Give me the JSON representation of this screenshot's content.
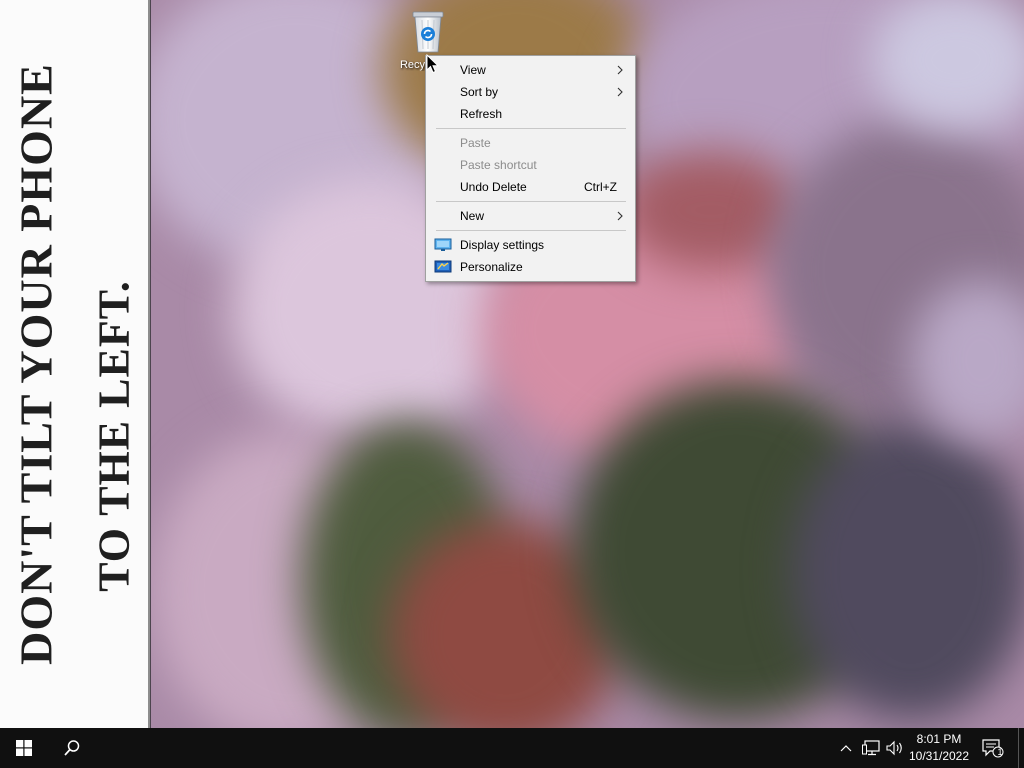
{
  "wallpaper": {
    "line1": "DON'T TILT YOUR PHONE",
    "line2": "TO THE LEFT."
  },
  "desktop": {
    "icons": [
      {
        "label": "Recycle Bin",
        "icon": "recycle-bin-icon"
      }
    ]
  },
  "context_menu": {
    "view": {
      "label": "View",
      "has_submenu": true
    },
    "sort_by": {
      "label": "Sort by",
      "has_submenu": true
    },
    "refresh": {
      "label": "Refresh"
    },
    "paste": {
      "label": "Paste",
      "disabled": true
    },
    "paste_shortcut": {
      "label": "Paste shortcut",
      "disabled": true
    },
    "undo_delete": {
      "label": "Undo Delete",
      "shortcut": "Ctrl+Z"
    },
    "new": {
      "label": "New",
      "has_submenu": true
    },
    "display_settings": {
      "label": "Display settings",
      "icon": "display-icon"
    },
    "personalize": {
      "label": "Personalize",
      "icon": "personalize-icon"
    }
  },
  "taskbar": {
    "start": {
      "icon": "windows-logo-icon"
    },
    "search": {
      "icon": "search-icon"
    },
    "tray": {
      "chevron_icon": "chevron-up-icon",
      "network_icon": "network-icon",
      "volume_icon": "volume-icon",
      "time": "8:01 PM",
      "date": "10/31/2022",
      "notifications_icon": "notification-icon",
      "notifications_count": "1"
    }
  },
  "colors": {
    "taskbar_bg": "#101010",
    "menu_bg": "#f2f2f2",
    "menu_disabled": "#8c8c8c",
    "accent": "#0078d7"
  }
}
